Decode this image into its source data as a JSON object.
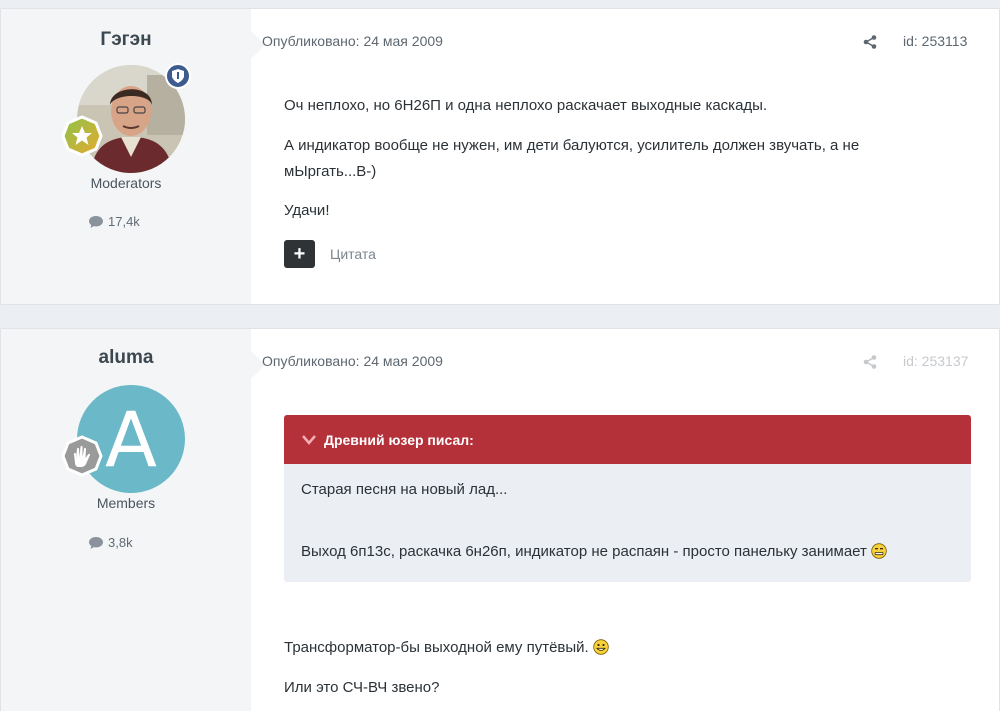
{
  "posts": [
    {
      "username": "Гэгэн",
      "group": "Moderators",
      "post_count": "17,4k",
      "published": "Опубликовано: 24 мая 2009",
      "post_id": "id: 253113",
      "paragraphs": [
        "Оч неплохо, но 6Н26П и одна неплохо раскачает выходные каскады.",
        "А индикатор вообще не нужен, им дети балуются, усилитель должен звучать, а не мЫргать...В-)",
        "Удачи!"
      ],
      "multiquote_label": "Цитата"
    },
    {
      "username": "aluma",
      "avatar_letter": "A",
      "group": "Members",
      "post_count": "3,8k",
      "published": "Опубликовано: 24 мая 2009",
      "post_id": "id: 253137",
      "quote": {
        "author": "Древний юзер писал:",
        "lines": [
          "Старая песня на новый лад...",
          "Выход 6п13с, раскачка 6н26п, индикатор не распаян - просто панельку занимает"
        ]
      },
      "paragraphs": [
        "Трансформатор-бы выходной ему путёвый.",
        "Или это СЧ-ВЧ звено?"
      ]
    }
  ],
  "colors": {
    "quote_header": "#b5313a",
    "avatar_letter_bg": "#6bb8c8",
    "moderator_badge": "#3e5b8f"
  }
}
